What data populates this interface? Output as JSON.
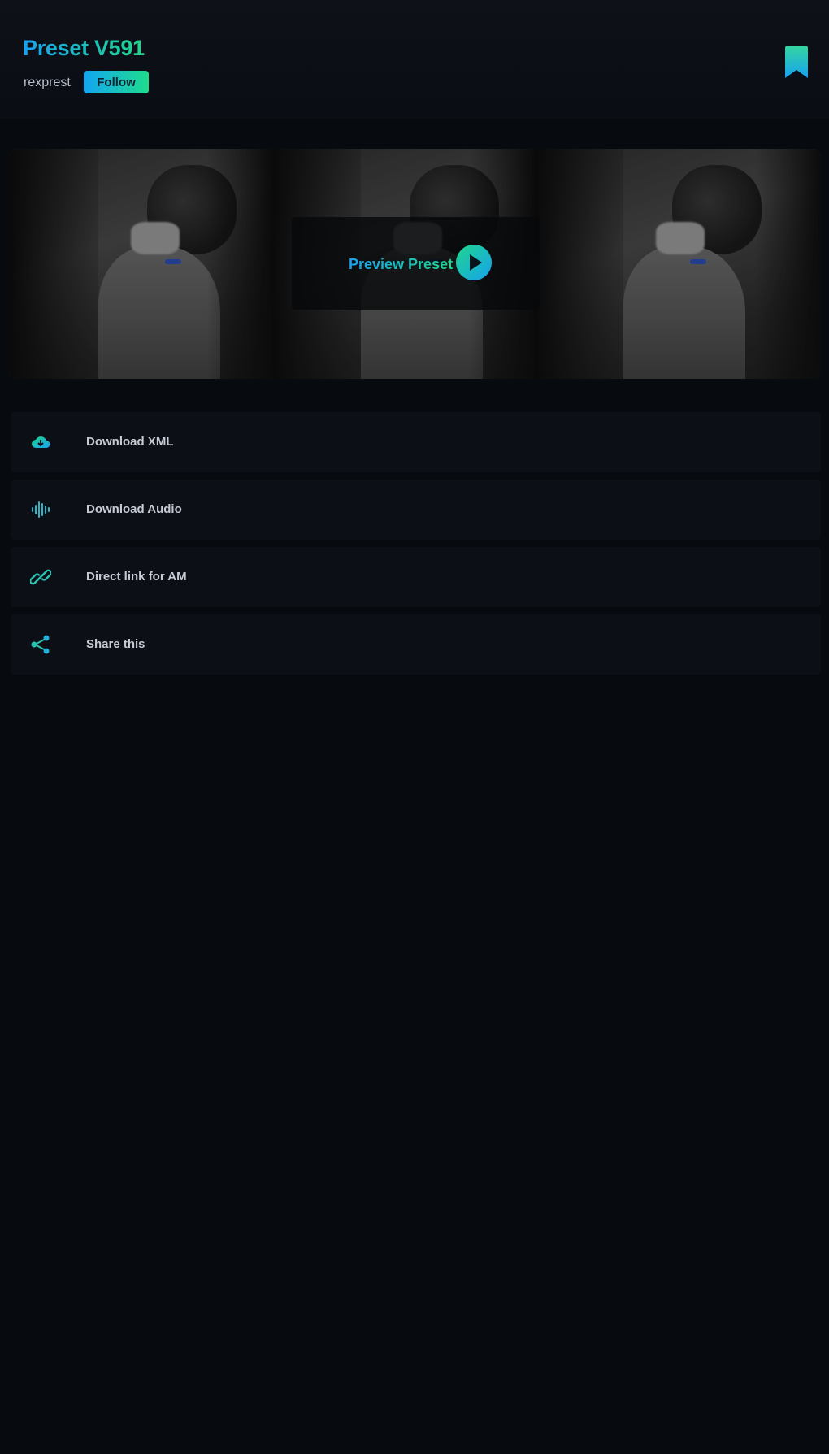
{
  "header": {
    "title": "Preset V591",
    "author": "rexprest",
    "follow_label": "Follow",
    "bookmark_icon": "bookmark-icon"
  },
  "preview": {
    "label": "Preview Preset",
    "play_icon": "play-icon"
  },
  "actions": [
    {
      "label": "Download XML",
      "icon": "cloud-download-icon"
    },
    {
      "label": "Download Audio",
      "icon": "audio-wave-icon"
    },
    {
      "label": "Direct link for AM",
      "icon": "link-icon"
    },
    {
      "label": "Share this",
      "icon": "share-icon"
    }
  ],
  "colors": {
    "background": "#070a0f",
    "accent_start": "#16a3f0",
    "accent_end": "#1fd58a",
    "card": "#0d0f17"
  }
}
